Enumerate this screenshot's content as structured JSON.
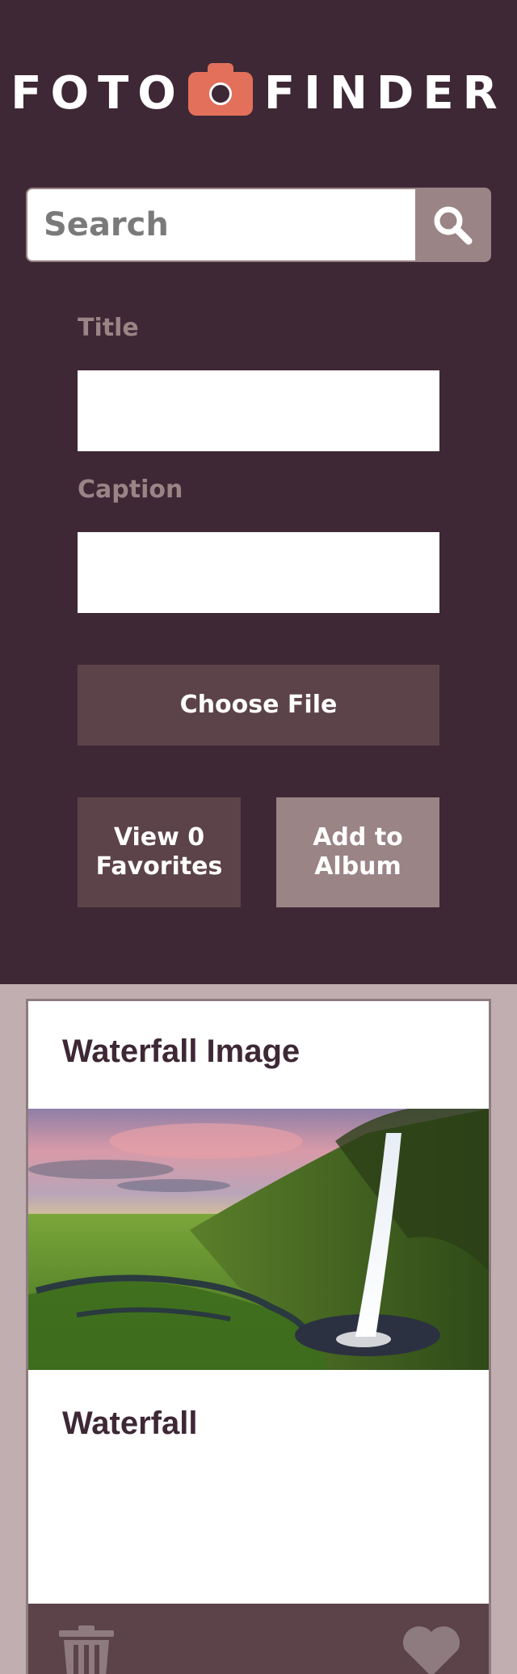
{
  "header": {
    "logo_left": "FOTO",
    "logo_right": "FINDER",
    "logo_icon": "camera-icon"
  },
  "search": {
    "placeholder": "Search",
    "button_icon": "search-icon"
  },
  "form": {
    "title_label": "Title",
    "caption_label": "Caption",
    "choose_file_label": "Choose File",
    "view_favorites_label": "View 0 Favorites",
    "add_to_album_label": "Add to Album"
  },
  "card": {
    "title": "Waterfall Image",
    "image_alt": "Waterfall",
    "caption": "Waterfall",
    "delete_icon": "trash-icon",
    "favorite_icon": "heart-icon"
  },
  "colors": {
    "header_bg": "#3e2835",
    "page_bg": "#c0aeb1",
    "logo_accent": "#e2705b",
    "button_dark": "#5c4349",
    "button_light": "#9a8486",
    "card_footer": "#5c4349"
  }
}
